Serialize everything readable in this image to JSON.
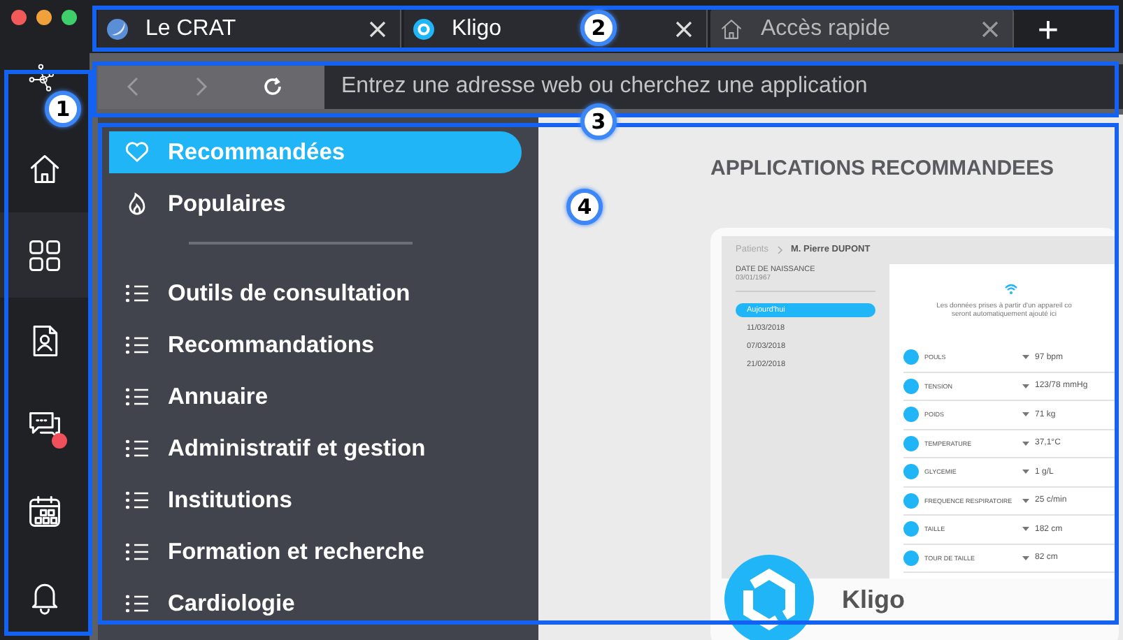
{
  "sidebar": {
    "items": [
      {
        "kind": "home",
        "selected": false,
        "notification": false
      },
      {
        "kind": "apps",
        "selected": true,
        "notification": false
      },
      {
        "kind": "contact",
        "selected": false,
        "notification": false
      },
      {
        "kind": "chat",
        "selected": false,
        "notification": true
      },
      {
        "kind": "calendar",
        "selected": false,
        "notification": false
      },
      {
        "kind": "bell",
        "selected": false,
        "notification": false
      }
    ]
  },
  "tabs": [
    {
      "title": "Le CRAT",
      "kind": "globe",
      "selected": false
    },
    {
      "title": "Kligo",
      "kind": "ring",
      "selected": false
    },
    {
      "title": "Accès rapide",
      "kind": "home",
      "selected": true
    }
  ],
  "new_tab": "+",
  "address_bar": {
    "placeholder": "Entrez une adresse web ou cherchez une application"
  },
  "categories": [
    {
      "kind": "heart",
      "label": "Recommandées",
      "selected": true
    },
    {
      "kind": "flame",
      "label": "Populaires",
      "selected": false
    },
    {
      "kind": "divider"
    },
    {
      "kind": "list",
      "label": "Outils de consultation",
      "selected": false
    },
    {
      "kind": "list",
      "label": "Recommandations",
      "selected": false
    },
    {
      "kind": "list",
      "label": "Annuaire",
      "selected": false
    },
    {
      "kind": "list",
      "label": "Administratif et gestion",
      "selected": false
    },
    {
      "kind": "list",
      "label": "Institutions",
      "selected": false
    },
    {
      "kind": "list",
      "label": "Formation et recherche",
      "selected": false
    },
    {
      "kind": "list",
      "label": "Cardiologie",
      "selected": false
    }
  ],
  "main": {
    "title": "APPLICATIONS RECOMMANDEES",
    "featured_app": {
      "name": "Kligo",
      "preview": {
        "breadcrumb": [
          "Patients",
          "M. Pierre DUPONT"
        ],
        "birth_label": "DATE DE NAISSANCE",
        "birth_date": "03/01/1967",
        "dates": [
          {
            "label": "Aujourd'hui",
            "selected": true
          },
          {
            "label": "11/03/2018",
            "selected": false
          },
          {
            "label": "07/03/2018",
            "selected": false
          },
          {
            "label": "21/02/2018",
            "selected": false
          }
        ],
        "notice": [
          "Les données prises à partir d'un appareil co",
          "seront automatiquement ajouté ici"
        ],
        "measures": [
          {
            "label": "POULS",
            "value": "97 bpm"
          },
          {
            "label": "TENSION",
            "value": "123/78 mmHg"
          },
          {
            "label": "POIDS",
            "value": "71 kg"
          },
          {
            "label": "TEMPERATURE",
            "value": "37,1°C"
          },
          {
            "label": "GLYCEMIE",
            "value": "1 g/L"
          },
          {
            "label": "FREQUENCE RESPIRATOIRE",
            "value": "25 c/min"
          },
          {
            "label": "TAILLE",
            "value": "182 cm"
          },
          {
            "label": "TOUR DE TAILLE",
            "value": "82 cm"
          }
        ]
      }
    }
  },
  "callouts": [
    {
      "number": "1"
    },
    {
      "number": "2"
    },
    {
      "number": "3"
    },
    {
      "number": "4"
    }
  ]
}
